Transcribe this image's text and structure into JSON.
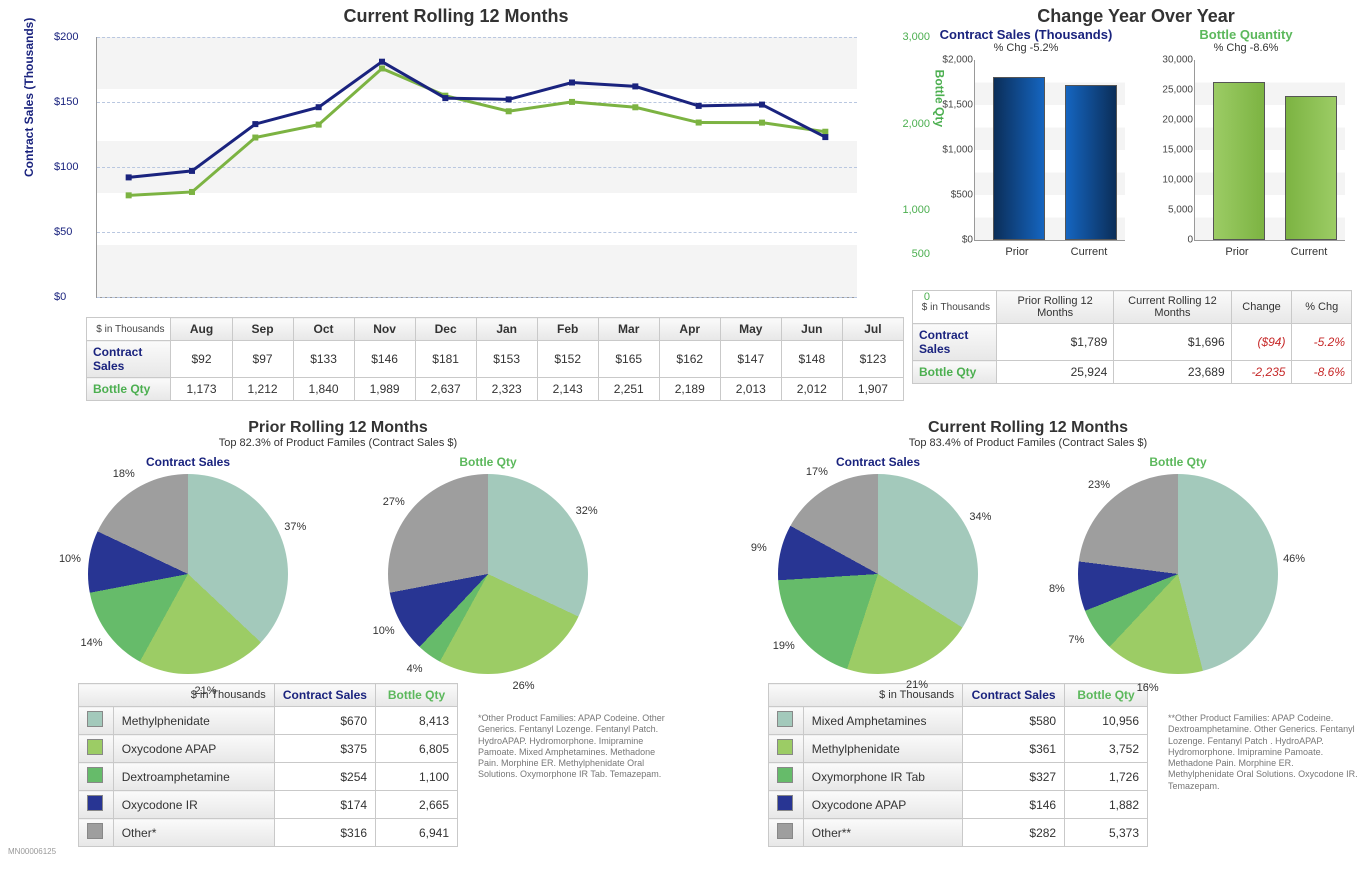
{
  "chart_data": [
    {
      "id": "rolling12_line",
      "type": "line",
      "title": "Current Rolling 12 Months",
      "xlabel": "",
      "y1label": "Contract Sales (Thousands)",
      "y2label": "Bottle Qty",
      "categories": [
        "Aug",
        "Sep",
        "Oct",
        "Nov",
        "Dec",
        "Jan",
        "Feb",
        "Mar",
        "Apr",
        "May",
        "Jun",
        "Jul"
      ],
      "y1lim": [
        0,
        200
      ],
      "y1ticks": [
        "$0",
        "$50",
        "$100",
        "$150",
        "$200"
      ],
      "y2lim": [
        0,
        3000
      ],
      "y2ticks": [
        "0",
        "500",
        "1,000",
        "2,000",
        "3,000"
      ],
      "series": [
        {
          "name": "Contract Sales",
          "axis": "y1",
          "values": [
            92,
            97,
            133,
            146,
            181,
            153,
            152,
            165,
            162,
            147,
            148,
            123
          ]
        },
        {
          "name": "Bottle Qty",
          "axis": "y2",
          "values": [
            1173,
            1212,
            1840,
            1989,
            2637,
            2323,
            2143,
            2251,
            2189,
            2013,
            2012,
            1907
          ]
        }
      ]
    },
    {
      "id": "yoy_sales_bar",
      "type": "bar",
      "title": "Contract Sales (Thousands)",
      "subtitle": "% Chg -5.2%",
      "categories": [
        "Prior",
        "Current"
      ],
      "values": [
        1789,
        1696
      ],
      "ylim": [
        0,
        2000
      ],
      "yticks": [
        "$0",
        "$500",
        "$1,000",
        "$1,500",
        "$2,000"
      ]
    },
    {
      "id": "yoy_qty_bar",
      "type": "bar",
      "title": "Bottle Quantity",
      "subtitle": "% Chg -8.6%",
      "categories": [
        "Prior",
        "Current"
      ],
      "values": [
        25924,
        23689
      ],
      "ylim": [
        0,
        30000
      ],
      "yticks": [
        "0",
        "5,000",
        "10,000",
        "15,000",
        "20,000",
        "25,000",
        "30,000"
      ]
    },
    {
      "id": "prior_sales_pie",
      "type": "pie",
      "title": "Contract Sales",
      "slices": [
        {
          "name": "Methylphenidate",
          "pct": 37
        },
        {
          "name": "Oxycodone APAP",
          "pct": 21
        },
        {
          "name": "Dextroamphetamine",
          "pct": 14
        },
        {
          "name": "Oxycodone IR",
          "pct": 10
        },
        {
          "name": "Other*",
          "pct": 18
        }
      ]
    },
    {
      "id": "prior_qty_pie",
      "type": "pie",
      "title": "Bottle Qty",
      "slices": [
        {
          "name": "Methylphenidate",
          "pct": 32
        },
        {
          "name": "Oxycodone APAP",
          "pct": 26
        },
        {
          "name": "Dextroamphetamine",
          "pct": 4
        },
        {
          "name": "Oxycodone IR",
          "pct": 10
        },
        {
          "name": "Other*",
          "pct": 27
        }
      ]
    },
    {
      "id": "curr_sales_pie",
      "type": "pie",
      "title": "Contract Sales",
      "slices": [
        {
          "name": "Mixed Amphetamines",
          "pct": 34
        },
        {
          "name": "Methylphenidate",
          "pct": 21
        },
        {
          "name": "Oxymorphone IR Tab",
          "pct": 19
        },
        {
          "name": "Oxycodone APAP",
          "pct": 9
        },
        {
          "name": "Other**",
          "pct": 17
        }
      ]
    },
    {
      "id": "curr_qty_pie",
      "type": "pie",
      "title": "Bottle Qty",
      "slices": [
        {
          "name": "Mixed Amphetamines",
          "pct": 46
        },
        {
          "name": "Methylphenidate",
          "pct": 16
        },
        {
          "name": "Oxymorphone IR Tab",
          "pct": 7
        },
        {
          "name": "Oxycodone APAP",
          "pct": 8
        },
        {
          "name": "Other**",
          "pct": 23
        }
      ]
    }
  ],
  "line_table": {
    "hdr": "$ in Thousands",
    "rows": [
      {
        "label": "Contract Sales",
        "cells": [
          "$92",
          "$97",
          "$133",
          "$146",
          "$181",
          "$153",
          "$152",
          "$165",
          "$162",
          "$147",
          "$148",
          "$123"
        ]
      },
      {
        "label": "Bottle Qty",
        "cells": [
          "1,173",
          "1,212",
          "1,840",
          "1,989",
          "2,637",
          "2,323",
          "2,143",
          "2,251",
          "2,189",
          "2,013",
          "2,012",
          "1,907"
        ]
      }
    ]
  },
  "yoy": {
    "title": "Change Year Over Year",
    "table": {
      "hdr": "$ in Thousands",
      "cols": [
        "Prior Rolling 12 Months",
        "Current Rolling 12 Months",
        "Change",
        "% Chg"
      ],
      "rows": [
        {
          "label": "Contract Sales",
          "cells": [
            "$1,789",
            "$1,696",
            "($94)",
            "-5.2%"
          ],
          "neg": [
            false,
            false,
            true,
            true
          ]
        },
        {
          "label": "Bottle Qty",
          "cells": [
            "25,924",
            "23,689",
            "-2,235",
            "-8.6%"
          ],
          "neg": [
            false,
            false,
            true,
            true
          ]
        }
      ]
    }
  },
  "prior": {
    "title": "Prior Rolling 12 Months",
    "sub": "Top 82.3% of Product Familes (Contract Sales $)",
    "table": {
      "hdr": "$ in Thousands",
      "cols": [
        "Contract Sales",
        "Bottle Qty"
      ],
      "rows": [
        {
          "name": "Methylphenidate",
          "sales": "$670",
          "qty": "8,413",
          "color": "#a3c9bb"
        },
        {
          "name": "Oxycodone APAP",
          "sales": "$375",
          "qty": "6,805",
          "color": "#9ccc65"
        },
        {
          "name": "Dextroamphetamine",
          "sales": "$254",
          "qty": "1,100",
          "color": "#66bb6a"
        },
        {
          "name": "Oxycodone IR",
          "sales": "$174",
          "qty": "2,665",
          "color": "#283593"
        },
        {
          "name": "Other*",
          "sales": "$316",
          "qty": "6,941",
          "color": "#9e9e9e"
        }
      ]
    },
    "footnote": "*Other Product Families:\nAPAP Codeine. Other Generics. Fentanyl Lozenge. Fentanyl Patch. HydroAPAP. Hydromorphone. Imipramine Pamoate. Mixed Amphetamines. Methadone Pain. Morphine ER. Methylphenidate Oral Solutions. Oxymorphone IR Tab. Temazepam."
  },
  "curr": {
    "title": "Current Rolling 12 Months",
    "sub": "Top 83.4% of Product Familes (Contract Sales $)",
    "table": {
      "hdr": "$ in Thousands",
      "cols": [
        "Contract Sales",
        "Bottle Qty"
      ],
      "rows": [
        {
          "name": "Mixed Amphetamines",
          "sales": "$580",
          "qty": "10,956",
          "color": "#a3c9bb"
        },
        {
          "name": "Methylphenidate",
          "sales": "$361",
          "qty": "3,752",
          "color": "#9ccc65"
        },
        {
          "name": "Oxymorphone IR Tab",
          "sales": "$327",
          "qty": "1,726",
          "color": "#66bb6a"
        },
        {
          "name": "Oxycodone APAP",
          "sales": "$146",
          "qty": "1,882",
          "color": "#283593"
        },
        {
          "name": "Other**",
          "sales": "$282",
          "qty": "5,373",
          "color": "#9e9e9e"
        }
      ]
    },
    "footnote": "**Other Product Families:\nAPAP Codeine. Dextroamphetamine. Other Generics. Fentanyl Lozenge. Fentanyl Patch . HydroAPAP. Hydromorphone. Imipramine Pamoate. Methadone Pain. Morphine ER. Methylphenidate Oral Solutions. Oxycodone IR. Temazepam."
  },
  "docid": "MN00006125"
}
